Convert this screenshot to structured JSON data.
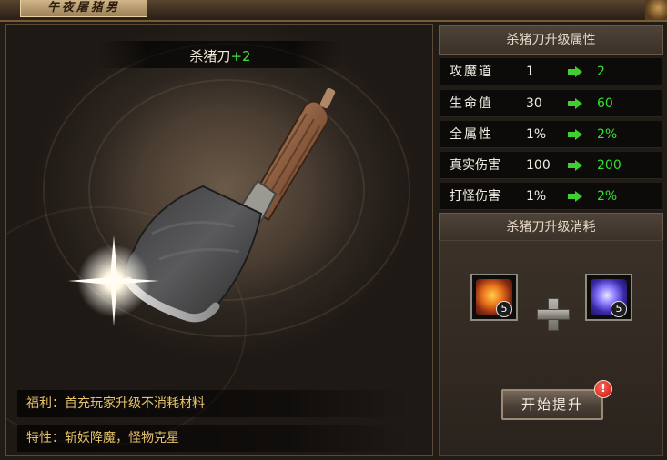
{
  "window": {
    "title": "午夜屠猪男"
  },
  "item": {
    "name": "杀猪刀",
    "level_bonus": "+2"
  },
  "info": {
    "benefit_label": "福利：",
    "benefit_text": "首充玩家升级不消耗材料",
    "trait_label": "特性：",
    "trait_text": "斩妖降魔，怪物克星"
  },
  "upgrade_attributes": {
    "header": "杀猪刀升级属性",
    "rows": [
      {
        "name": "攻魔道",
        "current": "1",
        "next": "2"
      },
      {
        "name": "生命值",
        "current": "30",
        "next": "60"
      },
      {
        "name": "全属性",
        "current": "1%",
        "next": "2%"
      },
      {
        "name": "真实伤害",
        "current": "100",
        "next": "200"
      },
      {
        "name": "打怪伤害",
        "current": "1%",
        "next": "2%"
      }
    ]
  },
  "upgrade_cost": {
    "header": "杀猪刀升级消耗",
    "materials": [
      {
        "icon": "fire-gem-icon",
        "count": "5"
      },
      {
        "icon": "blue-crystal-icon",
        "count": "5"
      }
    ],
    "start_button": "开始提升",
    "alert_badge": "!"
  },
  "colors": {
    "upgrade_value": "#33e02e",
    "info_text": "#e7c36a",
    "bonus": "#3fe035"
  }
}
